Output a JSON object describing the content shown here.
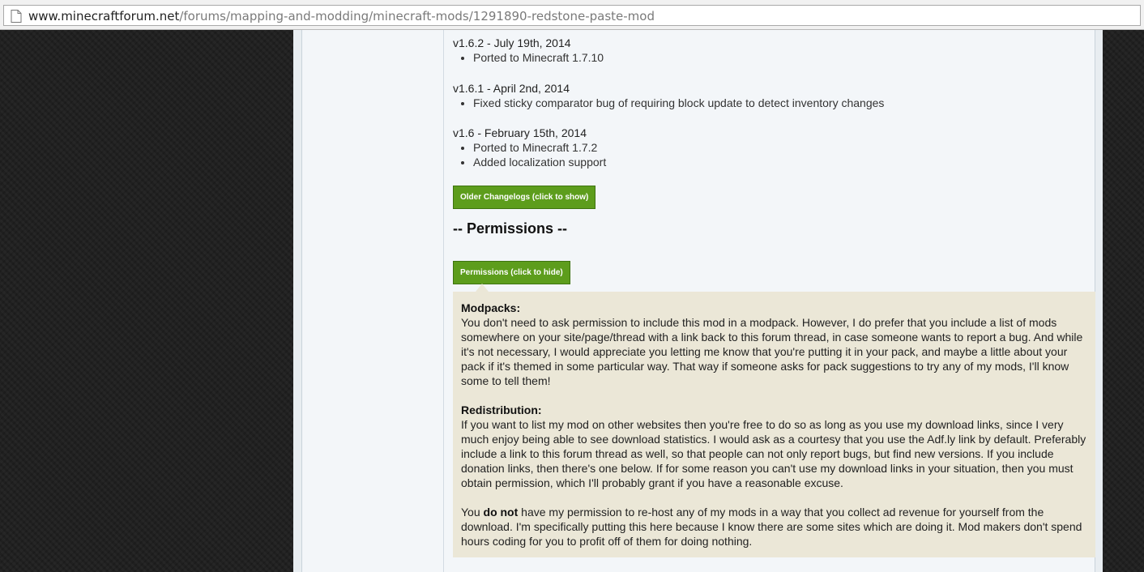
{
  "browser": {
    "url_host": "www.minecraftforum.net",
    "url_path": "/forums/mapping-and-modding/minecraft-mods/1291890-redstone-paste-mod"
  },
  "changelog": [
    {
      "header": "v1.6.2 - July 19th, 2014",
      "items": [
        "Ported to Minecraft 1.7.10"
      ]
    },
    {
      "header": "v1.6.1 - April 2nd, 2014",
      "items": [
        "Fixed sticky comparator bug of requiring block update to detect inventory changes"
      ]
    },
    {
      "header": "v1.6 - February 15th, 2014",
      "items": [
        "Ported to Minecraft 1.7.2",
        "Added localization support"
      ]
    }
  ],
  "older_changelogs_button": "Older Changelogs (click to show)",
  "permissions_heading": "-- Permissions --",
  "permissions_button": "Permissions (click to hide)",
  "permissions": {
    "modpacks_title": "Modpacks:",
    "modpacks_text": "You don't need to ask permission to include this mod in a modpack. However, I do prefer that you include a list of mods somewhere on your site/page/thread with a link back to this forum thread, in case someone wants to report a bug. And while it's not necessary, I would appreciate you letting me know that you're putting it in your pack, and maybe a little about your pack if it's themed in some particular way. That way if someone asks for pack suggestions to try any of my mods, I'll know some to tell them!",
    "redistribution_title": "Redistribution:",
    "redistribution_text": "If you want to list my mod on other websites then you're free to do so as long as you use my download links, since I very much enjoy being able to see download statistics. I would ask as a courtesy that you use the Adf.ly link by default. Preferably include a link to this forum thread as well, so that people can not only report bugs, but find new versions. If you include donation links, then there's one below. If for some reason you can't use my download links in your situation, then you must obtain permission, which I'll probably grant if you have a reasonable excuse.",
    "rehost_prefix": "You",
    "rehost_bold": "do not",
    "rehost_text": "have my permission to re-host any of my mods in a way that you collect ad revenue for yourself from the download. I'm specifically putting this here because I know there are some sites which are doing it. Mod makers don't spend hours coding for you to profit off of them for doing nothing."
  }
}
